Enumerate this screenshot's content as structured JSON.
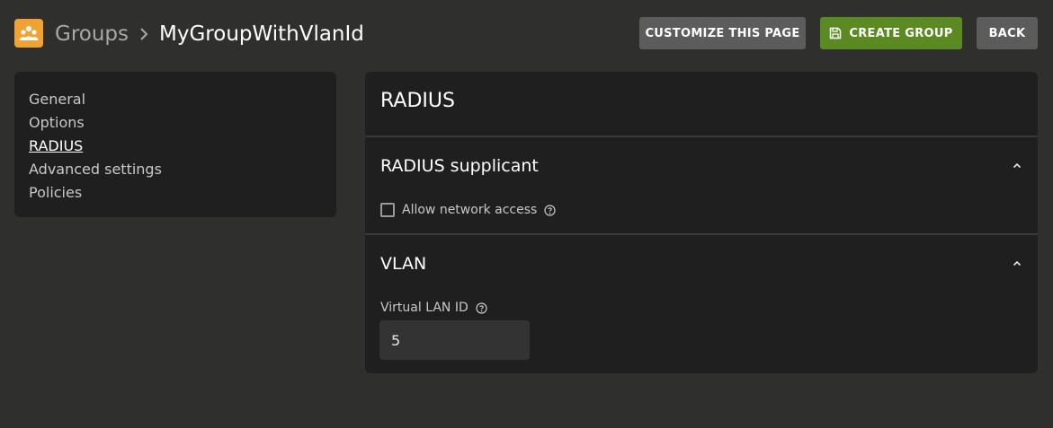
{
  "header": {
    "app_icon": "group-users-icon",
    "breadcrumb_parent": "Groups",
    "breadcrumb_separator_icon": "chevron-right-icon",
    "breadcrumb_current": "MyGroupWithVlanId",
    "buttons": {
      "customize": "CUSTOMIZE THIS PAGE",
      "create": "CREATE GROUP",
      "create_icon": "save-icon",
      "back": "BACK"
    }
  },
  "sidebar": {
    "items": [
      {
        "label": "General"
      },
      {
        "label": "Options"
      },
      {
        "label": "RADIUS",
        "active": true
      },
      {
        "label": "Advanced settings"
      },
      {
        "label": "Policies"
      }
    ]
  },
  "panel": {
    "title": "RADIUS",
    "sections": [
      {
        "title": "RADIUS supplicant",
        "checkbox_label": "Allow network access",
        "checkbox_checked": false
      },
      {
        "title": "VLAN",
        "field_label": "Virtual LAN ID",
        "field_value": "5"
      }
    ]
  },
  "colors": {
    "background": "#2f2f2d",
    "card": "#1f1f1f",
    "accent_green": "#5c8a22",
    "app_icon": "#f0a232",
    "button_gray": "#5c5c5c"
  }
}
